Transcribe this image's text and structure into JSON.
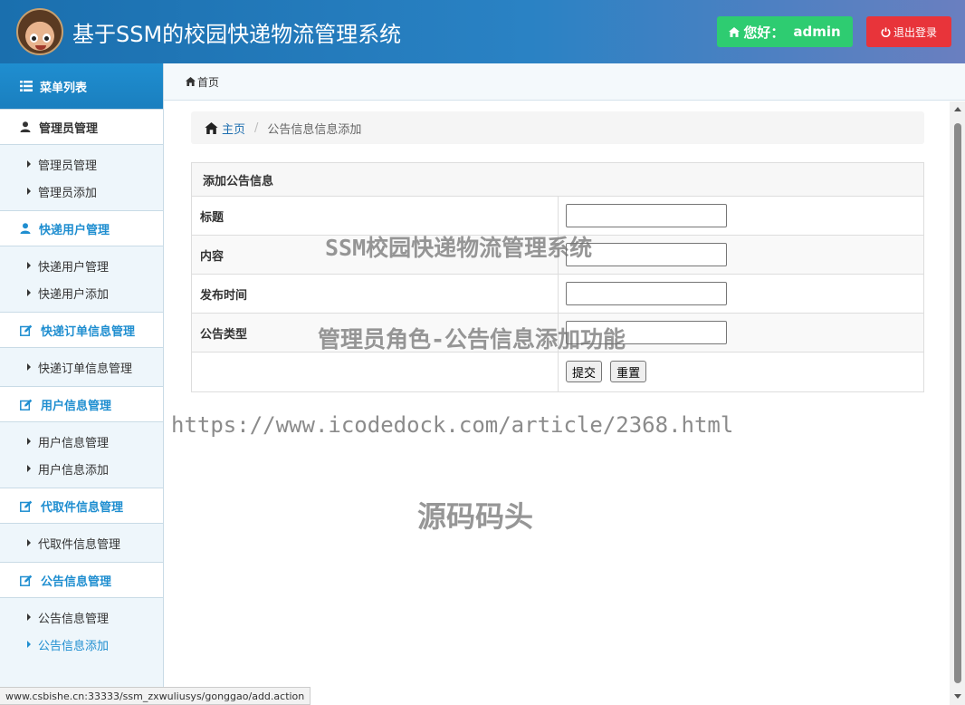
{
  "header": {
    "title": "基于SSM的校园快递物流管理系统",
    "greeting": "您好：",
    "username": "admin",
    "logout_label": "退出登录"
  },
  "sidebar": {
    "menu_title": "菜单列表",
    "groups": [
      {
        "title": "管理员管理",
        "icon": "user-icon",
        "items": [
          "管理员管理",
          "管理员添加"
        ]
      },
      {
        "title": "快递用户管理",
        "icon": "user-icon",
        "items": [
          "快递用户管理",
          "快递用户添加"
        ]
      },
      {
        "title": "快递订单信息管理",
        "icon": "edit-icon",
        "items": [
          "快递订单信息管理"
        ]
      },
      {
        "title": "用户信息管理",
        "icon": "edit-icon",
        "items": [
          "用户信息管理",
          "用户信息添加"
        ]
      },
      {
        "title": "代取件信息管理",
        "icon": "edit-icon",
        "items": [
          "代取件信息管理"
        ]
      },
      {
        "title": "公告信息管理",
        "icon": "edit-icon",
        "items": [
          "公告信息管理",
          "公告信息添加"
        ]
      }
    ]
  },
  "topbar": {
    "home_label": "首页"
  },
  "breadcrumb": {
    "home": "主页",
    "current": "公告信息信息添加"
  },
  "form": {
    "title": "添加公告信息",
    "fields": [
      {
        "label": "标题",
        "value": ""
      },
      {
        "label": "内容",
        "value": ""
      },
      {
        "label": "发布时间",
        "value": ""
      },
      {
        "label": "公告类型",
        "value": ""
      }
    ],
    "submit_label": "提交",
    "reset_label": "重置"
  },
  "watermarks": {
    "line1": "SSM校园快递物流管理系统",
    "line2": "管理员角色-公告信息添加功能",
    "line3": "https://www.icodedock.com/article/2368.html",
    "line4": "源码码头"
  },
  "status_url": "www.csbishe.cn:33333/ssm_zxwuliusys/gonggao/add.action",
  "colors": {
    "accent": "#1f8ed0",
    "header": "#1a6fae",
    "greet": "#2ecc71",
    "logout": "#e8343a"
  }
}
